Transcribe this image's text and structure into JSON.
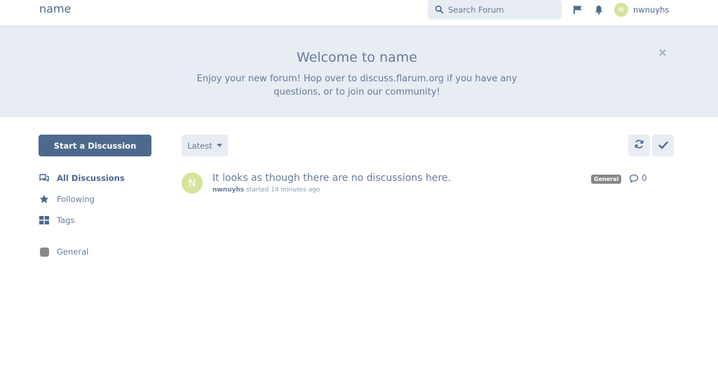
{
  "header": {
    "brand": "name",
    "search_placeholder": "Search Forum",
    "flag_icon": "flag-icon",
    "bell_icon": "bell-icon",
    "user_initial": "N",
    "username": "nwnuyhs"
  },
  "hero": {
    "title": "Welcome to name",
    "text": "Enjoy your new forum! Hop over to discuss.flarum.org if you have any questions, or to join our community!"
  },
  "sidebar": {
    "start_button": "Start a Discussion",
    "items": [
      {
        "label": "All Discussions",
        "icon": "comments-icon",
        "active": true
      },
      {
        "label": "Following",
        "icon": "star-icon",
        "active": false
      },
      {
        "label": "Tags",
        "icon": "grid-icon",
        "active": false
      },
      {
        "label": "General",
        "icon": "tag-swatch",
        "active": false
      }
    ]
  },
  "toolbar": {
    "sort_label": "Latest",
    "refresh_icon": "refresh-icon",
    "mark_read_icon": "check-icon"
  },
  "discussion": {
    "avatar_initial": "N",
    "title": "It looks as though there are no discussions here.",
    "author": "nwnuyhs",
    "meta": "started 14 minutes ago",
    "tag": "General",
    "reply_count": "0"
  },
  "colors": {
    "primary": "#4d698e",
    "hero_bg": "#e8ecf3",
    "avatar": "#d4e59a",
    "tag_general": "#888888"
  }
}
